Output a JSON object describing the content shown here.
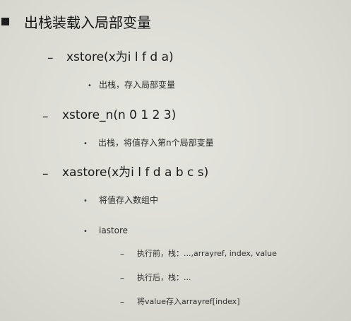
{
  "slide": {
    "heading": "出栈装载入局部变量",
    "items": [
      {
        "marker": "–",
        "text": "xstore(x为i l f d a)",
        "sub": [
          {
            "marker": "•",
            "text": "出栈，存入局部变量"
          }
        ]
      },
      {
        "marker": "–",
        "text": "xstore_n(n 0 1 2 3)",
        "sub": [
          {
            "marker": "•",
            "text": "出栈，将值存入第n个局部变量"
          }
        ]
      },
      {
        "marker": "–",
        "text": "xastore(x为i l f d a b c s)",
        "sub": [
          {
            "marker": "•",
            "text": "将值存入数组中"
          },
          {
            "marker": "•",
            "text": "iastore",
            "sub": [
              {
                "marker": "–",
                "text": "执行前，栈：...,arrayref, index, value"
              },
              {
                "marker": "–",
                "text": "执行后，栈：..."
              },
              {
                "marker": "–",
                "text": "将value存入arrayref[index]"
              }
            ]
          }
        ]
      }
    ]
  }
}
